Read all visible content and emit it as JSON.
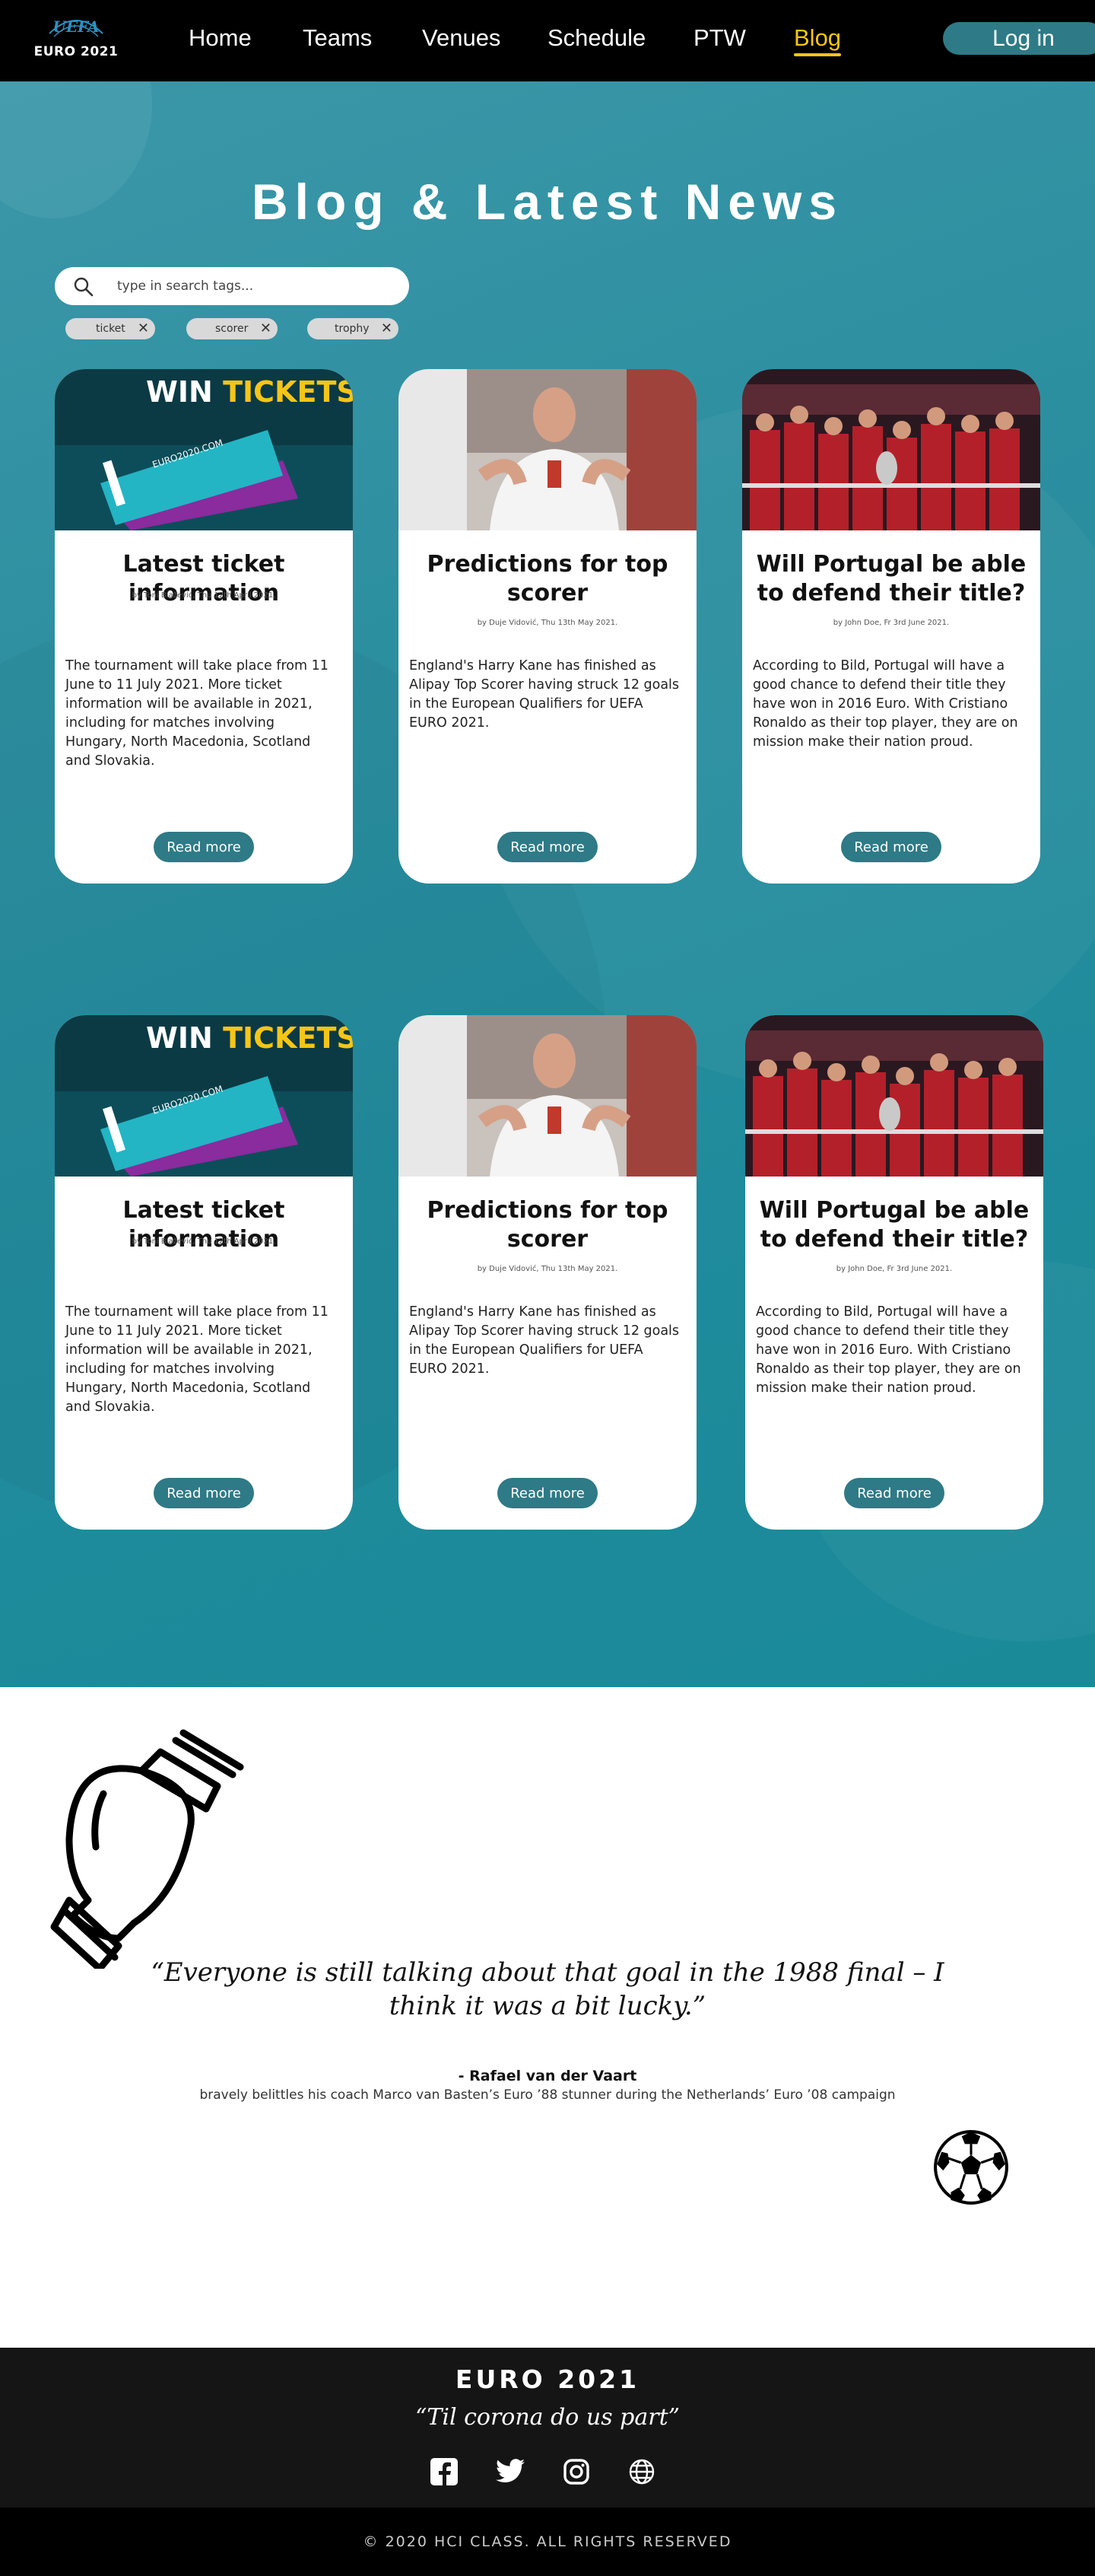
{
  "brand": {
    "logo_script": "UEFA",
    "logo_text": "EURO 2021"
  },
  "nav": {
    "items": [
      {
        "label": "Home"
      },
      {
        "label": "Teams"
      },
      {
        "label": "Venues"
      },
      {
        "label": "Schedule"
      },
      {
        "label": "PTW"
      },
      {
        "label": "Blog",
        "active": true
      }
    ],
    "login_label": "Log in"
  },
  "colors": {
    "nav_bg": "#000000",
    "accent_teal": "#2e7a86",
    "active_link": "#f5c518",
    "hero_teal": "#2c8fa0",
    "footer_bg": "#151515"
  },
  "hero": {
    "title": "Blog & Latest News",
    "search": {
      "placeholder": "type in search tags..."
    },
    "tags": [
      "ticket",
      "scorer",
      "trophy"
    ]
  },
  "cards": [
    {
      "image": "win-tickets",
      "image_text": "WIN TICKETS",
      "title": "Latest ticket information",
      "meta": "by Toni Blažević, Thu 12th April 2021.",
      "body": "The tournament will take place from 11 June to 11 July 2021. More ticket information will be available in 2021, including for matches involving Hungary, North Macedonia, Scotland and Slovakia.",
      "button": "Read more"
    },
    {
      "image": "harry-kane",
      "title": "Predictions for top scorer",
      "meta": "by Duje Vidović, Thu 13th May 2021.",
      "body": "England's Harry Kane has finished as Alipay Top Scorer having struck 12 goals in the European Qualifiers for UEFA EURO 2021.",
      "button": "Read more"
    },
    {
      "image": "portugal-team",
      "title": "Will Portugal be able to defend their title?",
      "meta": "by John Doe, Fr 3rd June 2021.",
      "body": "According to Bild, Portugal will have a good chance to defend their title they have won in 2016 Euro. With Cristiano Ronaldo as their top player, they are on mission make their nation proud.",
      "button": "Read more"
    },
    {
      "image": "win-tickets",
      "image_text": "WIN TICKETS",
      "title": "Latest ticket information",
      "meta": "by Toni Blažević, Thu 12th April 2021.",
      "body": "The tournament will take place from 11 June to 11 July 2021. More ticket information will be available in 2021, including for matches involving Hungary, North Macedonia, Scotland and Slovakia.",
      "button": "Read more"
    },
    {
      "image": "harry-kane",
      "title": "Predictions for top scorer",
      "meta": "by Duje Vidović, Thu 13th May 2021.",
      "body": "England's Harry Kane has finished as Alipay Top Scorer having struck 12 goals in the European Qualifiers for UEFA EURO 2021.",
      "button": "Read more"
    },
    {
      "image": "portugal-team",
      "title": "Will Portugal be able to defend their title?",
      "meta": "by John Doe, Fr 3rd June 2021.",
      "body": "According to Bild, Portugal will have a good chance to defend their title they have won in 2016 Euro. With Cristiano Ronaldo as their top player, they are on mission make their nation proud.",
      "button": "Read more"
    }
  ],
  "quote": {
    "text": "“Everyone is still talking about that goal in the 1988 final – I think it was a bit lucky.”",
    "author": "- Rafael van der Vaart",
    "caption": "bravely belittles his coach Marco van Basten’s Euro ’88 stunner during the Netherlands’ Euro ’08 campaign",
    "icons": [
      "trophy-icon",
      "soccer-ball-icon"
    ]
  },
  "footer": {
    "title": "EURO 2021",
    "subtitle": "“Til corona do us part”",
    "socials": [
      "facebook-icon",
      "twitter-icon",
      "instagram-icon",
      "globe-icon"
    ],
    "copyright": "© 2020 HCI CLASS. ALL RIGHTS RESERVED"
  }
}
